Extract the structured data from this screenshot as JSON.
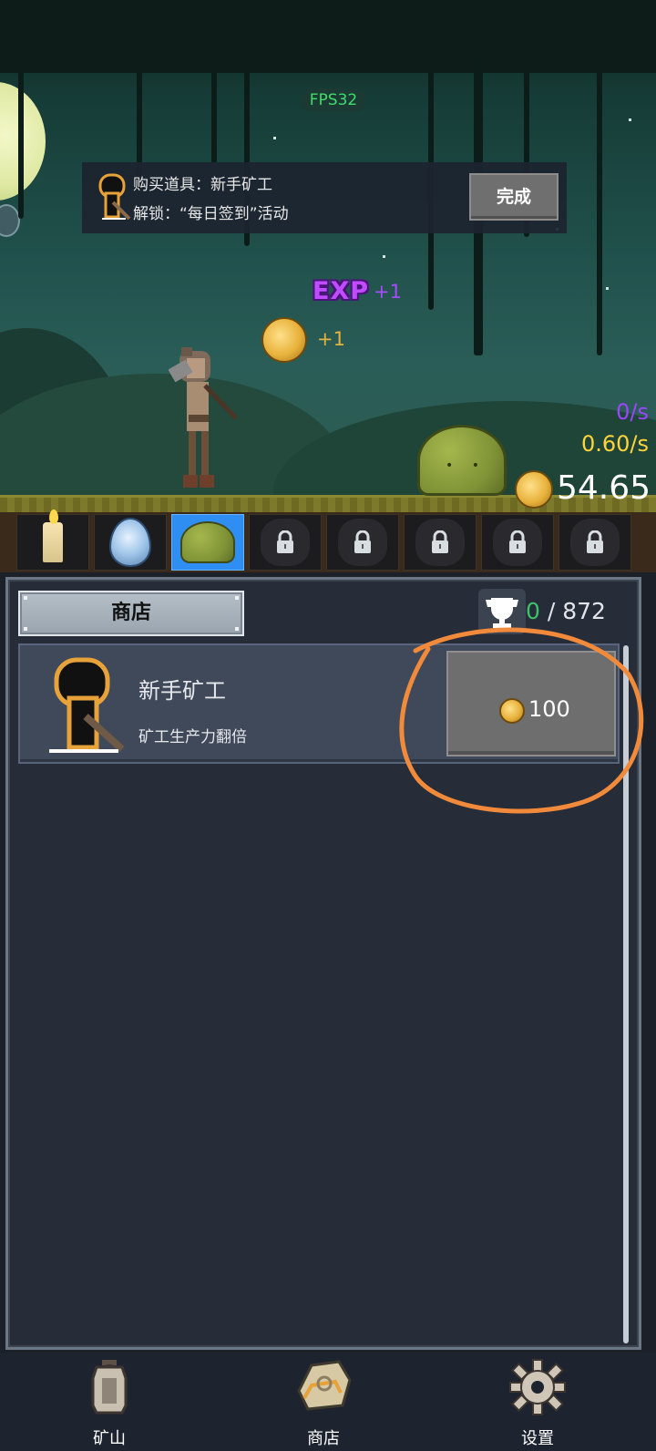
{
  "hud": {
    "fps": "FPS32",
    "rate_purple": "0/s",
    "rate_yellow": "0.60/s",
    "gold_amount": "54.65",
    "gold_icon": "coin-icon"
  },
  "quest": {
    "icon": "miner-silhouette-icon",
    "line1": "购买道具：新手矿工",
    "line2": "解锁：“每日签到”活动",
    "done_label": "完成"
  },
  "floating_rewards": {
    "exp_label": "EXP",
    "exp_value": "+1",
    "coin_value": "+1"
  },
  "monster_bar": [
    {
      "icon": "candle-icon",
      "locked": false,
      "selected": false
    },
    {
      "icon": "egg-icon",
      "locked": false,
      "selected": false
    },
    {
      "icon": "slime-icon",
      "locked": false,
      "selected": true
    },
    {
      "icon": "lock-icon",
      "locked": true,
      "selected": false
    },
    {
      "icon": "lock-icon",
      "locked": true,
      "selected": false
    },
    {
      "icon": "lock-icon",
      "locked": true,
      "selected": false
    },
    {
      "icon": "lock-icon",
      "locked": true,
      "selected": false
    },
    {
      "icon": "lock-icon",
      "locked": true,
      "selected": false
    }
  ],
  "shop": {
    "tab_label": "商店",
    "trophy_icon": "trophy-icon",
    "trophy_owned": "0",
    "trophy_total": " / 872",
    "items": [
      {
        "name": "新手矿工",
        "desc": "矿工生产力翻倍",
        "price": "100",
        "icon": "miner-silhouette-icon"
      }
    ]
  },
  "bottom_nav": [
    {
      "label": "矿山",
      "icon": "lantern-icon"
    },
    {
      "label": "商店",
      "icon": "ore-stone-icon"
    },
    {
      "label": "设置",
      "icon": "gear-icon"
    }
  ],
  "colors": {
    "selected_slot": "#2f8ef2",
    "exp_purple": "#c04cff",
    "gold_yellow": "#ffd43b",
    "trophy_green": "#3cc26b",
    "annotation_orange": "#f28a3c"
  }
}
